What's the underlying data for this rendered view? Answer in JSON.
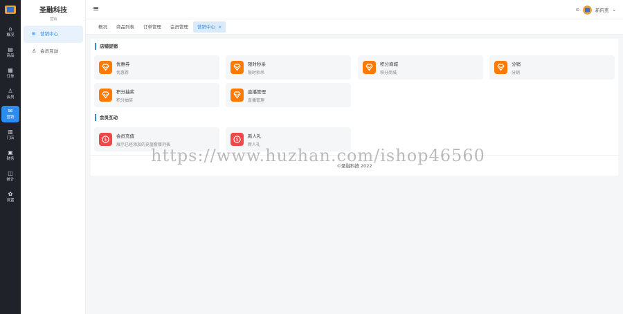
{
  "rail": {
    "items": [
      {
        "icon": "overview-icon",
        "glyph": "⌂",
        "label": "概况"
      },
      {
        "icon": "goods-icon",
        "glyph": "▤",
        "label": "商品"
      },
      {
        "icon": "order-icon",
        "glyph": "▦",
        "label": "订单"
      },
      {
        "icon": "member-icon",
        "glyph": "♙",
        "label": "会员"
      },
      {
        "icon": "marketing-icon",
        "glyph": "✉",
        "label": "营销"
      },
      {
        "icon": "store-icon",
        "glyph": "▥",
        "label": "门店"
      },
      {
        "icon": "finance-icon",
        "glyph": "▣",
        "label": "财务"
      },
      {
        "icon": "stats-icon",
        "glyph": "◫",
        "label": "统计"
      },
      {
        "icon": "settings-icon",
        "glyph": "✿",
        "label": "设置"
      }
    ],
    "active_index": 4
  },
  "submenu": {
    "brand": "圣融科技",
    "brand_sub": "营销",
    "items": [
      {
        "label": "营销中心",
        "icon": "gift-icon",
        "glyph": "⊞"
      },
      {
        "label": "会员互动",
        "icon": "user-icon",
        "glyph": "♙"
      }
    ]
  },
  "header": {
    "menu_glyph": "≡",
    "lock_glyph": "⊙",
    "username": "新内克",
    "caret": "⌄"
  },
  "tabs": [
    {
      "label": "概况"
    },
    {
      "label": "商品列表"
    },
    {
      "label": "订单管理"
    },
    {
      "label": "会员管理"
    },
    {
      "label": "营销中心",
      "close": "×"
    }
  ],
  "sections": {
    "promo": {
      "title": "店铺促销",
      "cards": [
        {
          "title": "优惠券",
          "desc": "优惠券"
        },
        {
          "title": "限时秒杀",
          "desc": "限时秒杀"
        },
        {
          "title": "积分商城",
          "desc": "积分商城"
        },
        {
          "title": "分销",
          "desc": "分销"
        },
        {
          "title": "积分抽奖",
          "desc": "积分抽奖"
        },
        {
          "title": "直播管理",
          "desc": "直播管理"
        }
      ]
    },
    "member": {
      "title": "会员互动",
      "cards": [
        {
          "title": "会员充值",
          "desc": "展示已经添加的充值套餐列表"
        },
        {
          "title": "新人礼",
          "desc": "新人礼"
        }
      ]
    }
  },
  "footer": {
    "copyright": "©圣融科技 2022"
  },
  "watermark": "https://www.huzhan.com/ishop46560",
  "colors": {
    "accent": "#2d8cf0",
    "promo_icon": "#ff7a00",
    "member_icon": "#f04848",
    "rail_bg": "#1f2329"
  }
}
